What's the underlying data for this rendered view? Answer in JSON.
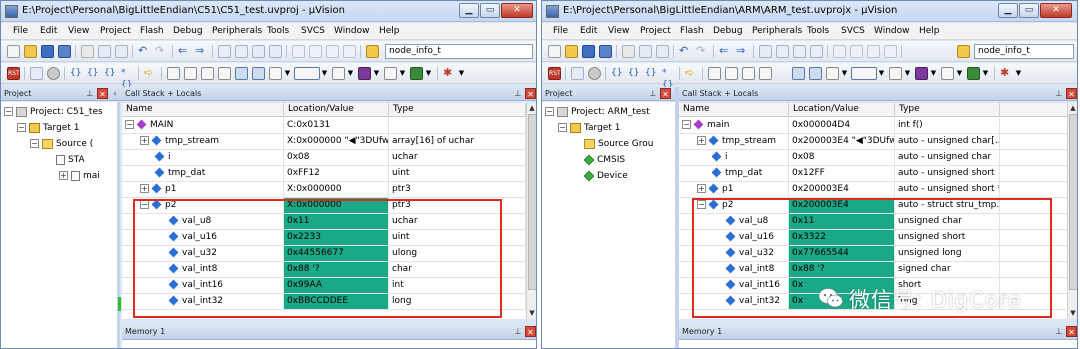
{
  "left": {
    "title": "E:\\Project\\Personal\\BigLittleEndian\\C51\\C51_test.uvproj - µVision",
    "menu": [
      "File",
      "Edit",
      "View",
      "Project",
      "Flash",
      "Debug",
      "Peripherals",
      "Tools",
      "SVCS",
      "Window",
      "Help"
    ],
    "search_value": "node_info_t",
    "project_pane_title": "Project",
    "project_tree": [
      "Project: C51_tes",
      "Target 1",
      "Source (",
      "STA",
      "mai"
    ],
    "callstack_title": "Call Stack + Locals",
    "columns": [
      "Name",
      "Location/Value",
      "Type"
    ],
    "rows": [
      {
        "name": "MAIN",
        "value": "C:0x0131",
        "type": ""
      },
      {
        "name": "tmp_stream",
        "value": "X:0x000000 \"◀\"3DUfw...",
        "type": "array[16] of uchar"
      },
      {
        "name": "i",
        "value": "0x08",
        "type": "uchar"
      },
      {
        "name": "tmp_dat",
        "value": "0xFF12",
        "type": "uint"
      },
      {
        "name": "p1",
        "value": "X:0x000000",
        "type": "ptr3"
      },
      {
        "name": "p2",
        "value": "X:0x000000",
        "type": "ptr3"
      },
      {
        "name": "val_u8",
        "value": "0x11",
        "type": "uchar"
      },
      {
        "name": "val_u16",
        "value": "0x2233",
        "type": "uint"
      },
      {
        "name": "val_u32",
        "value": "0x44556677",
        "type": "ulong"
      },
      {
        "name": "val_int8",
        "value": "0x88 '?",
        "type": "char"
      },
      {
        "name": "val_int16",
        "value": "0x99AA",
        "type": "int"
      },
      {
        "name": "val_int32",
        "value": "0xBBCCDDEE",
        "type": "long"
      }
    ],
    "memory_title": "Memory 1"
  },
  "right": {
    "title": "E:\\Project\\Personal\\BigLittleEndian\\ARM\\ARM_test.uvprojx - µVision",
    "menu": [
      "File",
      "Edit",
      "View",
      "Project",
      "Flash",
      "Debug",
      "Peripherals",
      "Tools",
      "SVCS",
      "Window",
      "Help"
    ],
    "search_value": "node_info_t",
    "project_pane_title": "Project",
    "project_tree": [
      "Project: ARM_test",
      "Target 1",
      "Source Grou",
      "CMSIS",
      "Device"
    ],
    "callstack_title": "Call Stack + Locals",
    "columns": [
      "Name",
      "Location/Value",
      "Type"
    ],
    "rows": [
      {
        "name": "main",
        "value": "0x000004D4",
        "type": "int f()"
      },
      {
        "name": "tmp_stream",
        "value": "0x200003E4 \"◀\"3DUfw...",
        "type": "auto - unsigned char[..."
      },
      {
        "name": "i",
        "value": "0x08",
        "type": "auto - unsigned char"
      },
      {
        "name": "tmp_dat",
        "value": "0x12FF",
        "type": "auto - unsigned short"
      },
      {
        "name": "p1",
        "value": "0x200003E4",
        "type": "auto - unsigned short *"
      },
      {
        "name": "p2",
        "value": "0x200003E4",
        "type": "auto - struct stru_tmp..."
      },
      {
        "name": "val_u8",
        "value": "0x11",
        "type": "unsigned char"
      },
      {
        "name": "val_u16",
        "value": "0x3322",
        "type": "unsigned short"
      },
      {
        "name": "val_u32",
        "value": "0x77665544",
        "type": "unsigned long"
      },
      {
        "name": "val_int8",
        "value": "0x88 '?",
        "type": "signed char"
      },
      {
        "name": "val_int16",
        "value": "0x",
        "type": "short"
      },
      {
        "name": "val_int32",
        "value": "0x",
        "type": "long"
      }
    ],
    "memory_title": "Memory 1"
  },
  "watermark": "微信号: DigCore",
  "colors": {
    "value_highlight": "#1aa987",
    "annotation_box": "#e0291e",
    "title_bg": "#c5d7ef"
  }
}
